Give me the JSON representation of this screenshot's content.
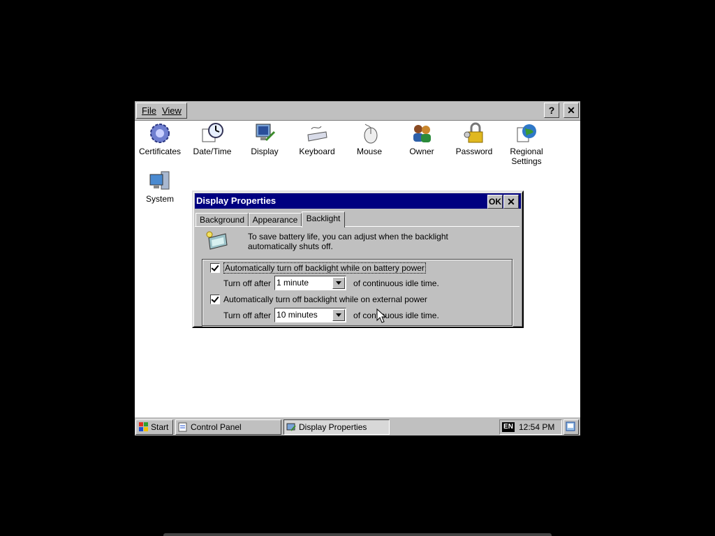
{
  "menubar": {
    "file": "File",
    "view": "View",
    "help": "?",
    "close": "✕"
  },
  "icons": [
    {
      "label": "Certificates",
      "icon": "certificates-icon"
    },
    {
      "label": "Date/Time",
      "icon": "date-time-icon"
    },
    {
      "label": "Display",
      "icon": "display-icon"
    },
    {
      "label": "Keyboard",
      "icon": "keyboard-icon"
    },
    {
      "label": "Mouse",
      "icon": "mouse-icon"
    },
    {
      "label": "Owner",
      "icon": "owner-icon"
    },
    {
      "label": "Password",
      "icon": "password-icon"
    },
    {
      "label": "Regional Settings",
      "label_line1": "Regional",
      "label_line2": "Settings",
      "icon": "regional-settings-icon"
    },
    {
      "label": "System",
      "icon": "system-icon"
    }
  ],
  "dialog": {
    "title": "Display Properties",
    "ok": "OK",
    "close": "✕",
    "tabs": [
      "Background",
      "Appearance",
      "Backlight"
    ],
    "active_tab": "Backlight",
    "info_line1": "To save battery life, you can adjust when the backlight",
    "info_line2": "automatically shuts off.",
    "battery": {
      "checked": true,
      "label": "Automatically turn off backlight while on battery power",
      "turn_off": "Turn off after",
      "value": "1 minute",
      "suffix": "of continuous idle time."
    },
    "external": {
      "checked": true,
      "label": "Automatically turn off backlight while on external power",
      "turn_off": "Turn off after",
      "value": "10 minutes",
      "suffix": "of continuous idle time."
    }
  },
  "taskbar": {
    "start": "Start",
    "tasks": [
      "Control Panel",
      "Display Properties"
    ],
    "lang": "EN",
    "clock": "12:54 PM"
  },
  "colors": {
    "titlebar": "#000080",
    "face": "#c0c0c0"
  }
}
